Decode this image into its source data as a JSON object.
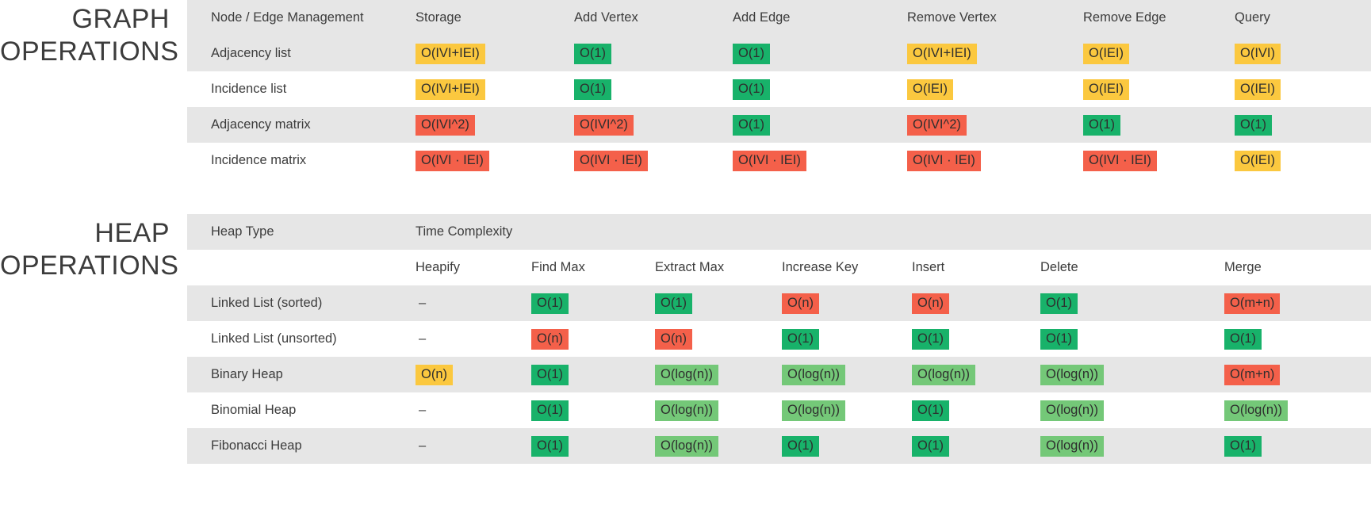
{
  "colors": {
    "green": "#18b26a",
    "light_green": "#74c878",
    "yellow": "#fbc83f",
    "red": "#f4604a",
    "row_shade": "#e6e6e6",
    "text": "#3c3c3c"
  },
  "graph": {
    "title": "GRAPH\nOPERATIONS",
    "columns": [
      "Node / Edge Management",
      "Storage",
      "Add Vertex",
      "Add Edge",
      "Remove Vertex",
      "Remove Edge",
      "Query"
    ],
    "rows": [
      {
        "name": "Adjacency list",
        "cells": [
          {
            "text": "O(IVI+IEI)",
            "color": "yellow"
          },
          {
            "text": "O(1)",
            "color": "green"
          },
          {
            "text": "O(1)",
            "color": "green"
          },
          {
            "text": "O(IVI+IEI)",
            "color": "yellow"
          },
          {
            "text": "O(IEI)",
            "color": "yellow"
          },
          {
            "text": "O(IVI)",
            "color": "yellow"
          }
        ]
      },
      {
        "name": "Incidence list",
        "cells": [
          {
            "text": "O(IVI+IEI)",
            "color": "yellow"
          },
          {
            "text": "O(1)",
            "color": "green"
          },
          {
            "text": "O(1)",
            "color": "green"
          },
          {
            "text": "O(IEI)",
            "color": "yellow"
          },
          {
            "text": "O(IEI)",
            "color": "yellow"
          },
          {
            "text": "O(IEI)",
            "color": "yellow"
          }
        ]
      },
      {
        "name": "Adjacency matrix",
        "cells": [
          {
            "text": "O(IVI^2)",
            "color": "red"
          },
          {
            "text": "O(IVI^2)",
            "color": "red"
          },
          {
            "text": "O(1)",
            "color": "green"
          },
          {
            "text": "O(IVI^2)",
            "color": "red"
          },
          {
            "text": "O(1)",
            "color": "green"
          },
          {
            "text": "O(1)",
            "color": "green"
          }
        ]
      },
      {
        "name": "Incidence matrix",
        "cells": [
          {
            "text": "O(IVI · IEI)",
            "color": "red"
          },
          {
            "text": "O(IVI · IEI)",
            "color": "red"
          },
          {
            "text": "O(IVI · IEI)",
            "color": "red"
          },
          {
            "text": "O(IVI · IEI)",
            "color": "red"
          },
          {
            "text": "O(IVI · IEI)",
            "color": "red"
          },
          {
            "text": "O(IEI)",
            "color": "yellow"
          }
        ]
      }
    ]
  },
  "heap": {
    "title": "HEAP\nOPERATIONS",
    "group_header": {
      "row_label": "Heap Type",
      "group_label": "Time Complexity"
    },
    "columns": [
      "",
      "Heapify",
      "Find Max",
      "Extract Max",
      "Increase Key",
      "Insert",
      "Delete",
      "Merge"
    ],
    "rows": [
      {
        "name": "Linked List (sorted)",
        "cells": [
          {
            "text": "–",
            "color": "none"
          },
          {
            "text": "O(1)",
            "color": "green"
          },
          {
            "text": "O(1)",
            "color": "green"
          },
          {
            "text": "O(n)",
            "color": "red"
          },
          {
            "text": "O(n)",
            "color": "red"
          },
          {
            "text": "O(1)",
            "color": "green"
          },
          {
            "text": "O(m+n)",
            "color": "red"
          }
        ]
      },
      {
        "name": "Linked List (unsorted)",
        "cells": [
          {
            "text": "–",
            "color": "none"
          },
          {
            "text": "O(n)",
            "color": "red"
          },
          {
            "text": "O(n)",
            "color": "red"
          },
          {
            "text": "O(1)",
            "color": "green"
          },
          {
            "text": "O(1)",
            "color": "green"
          },
          {
            "text": "O(1)",
            "color": "green"
          },
          {
            "text": "O(1)",
            "color": "green"
          }
        ]
      },
      {
        "name": "Binary Heap",
        "cells": [
          {
            "text": "O(n)",
            "color": "yellow"
          },
          {
            "text": "O(1)",
            "color": "green"
          },
          {
            "text": "O(log(n))",
            "color": "lgreen"
          },
          {
            "text": "O(log(n))",
            "color": "lgreen"
          },
          {
            "text": "O(log(n))",
            "color": "lgreen"
          },
          {
            "text": "O(log(n))",
            "color": "lgreen"
          },
          {
            "text": "O(m+n)",
            "color": "red"
          }
        ]
      },
      {
        "name": "Binomial Heap",
        "cells": [
          {
            "text": "–",
            "color": "none"
          },
          {
            "text": "O(1)",
            "color": "green"
          },
          {
            "text": "O(log(n))",
            "color": "lgreen"
          },
          {
            "text": "O(log(n))",
            "color": "lgreen"
          },
          {
            "text": "O(1)",
            "color": "green"
          },
          {
            "text": "O(log(n))",
            "color": "lgreen"
          },
          {
            "text": "O(log(n))",
            "color": "lgreen"
          }
        ]
      },
      {
        "name": "Fibonacci Heap",
        "cells": [
          {
            "text": "–",
            "color": "none"
          },
          {
            "text": "O(1)",
            "color": "green"
          },
          {
            "text": "O(log(n))",
            "color": "lgreen"
          },
          {
            "text": "O(1)",
            "color": "green"
          },
          {
            "text": "O(1)",
            "color": "green"
          },
          {
            "text": "O(log(n))",
            "color": "lgreen"
          },
          {
            "text": "O(1)",
            "color": "green"
          }
        ]
      }
    ]
  }
}
